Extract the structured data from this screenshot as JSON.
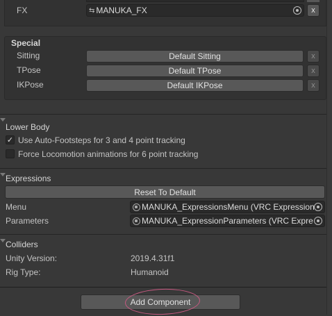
{
  "fx": {
    "label": "FX",
    "icon": "animator-controller-icon",
    "value": "MANUKA_FX",
    "clear_label": "x"
  },
  "special": {
    "heading": "Special",
    "rows": [
      {
        "label": "Sitting",
        "button": "Default Sitting",
        "clear": "x"
      },
      {
        "label": "TPose",
        "button": "Default TPose",
        "clear": "x"
      },
      {
        "label": "IKPose",
        "button": "Default IKPose",
        "clear": "x"
      }
    ]
  },
  "lower_body": {
    "heading": "Lower Body",
    "options": [
      {
        "label": "Use Auto-Footsteps for 3 and 4 point tracking",
        "checked": true,
        "check_glyph": "✓"
      },
      {
        "label": "Force Locomotion animations for 6 point tracking",
        "checked": false,
        "check_glyph": ""
      }
    ]
  },
  "expressions": {
    "heading": "Expressions",
    "reset_label": "Reset To Default",
    "menu": {
      "label": "Menu",
      "value": "MANUKA_ExpressionsMenu (VRC Expressions"
    },
    "parameters": {
      "label": "Parameters",
      "value": "MANUKA_ExpressionParameters (VRC Expre"
    }
  },
  "colliders": {
    "heading": "Colliders",
    "unity_version": {
      "label": "Unity Version:",
      "value": "2019.4.31f1"
    },
    "rig_type": {
      "label": "Rig Type:",
      "value": "Humanoid"
    }
  },
  "footer": {
    "add_component_label": "Add Component",
    "highlight_color": "#c85a82"
  }
}
